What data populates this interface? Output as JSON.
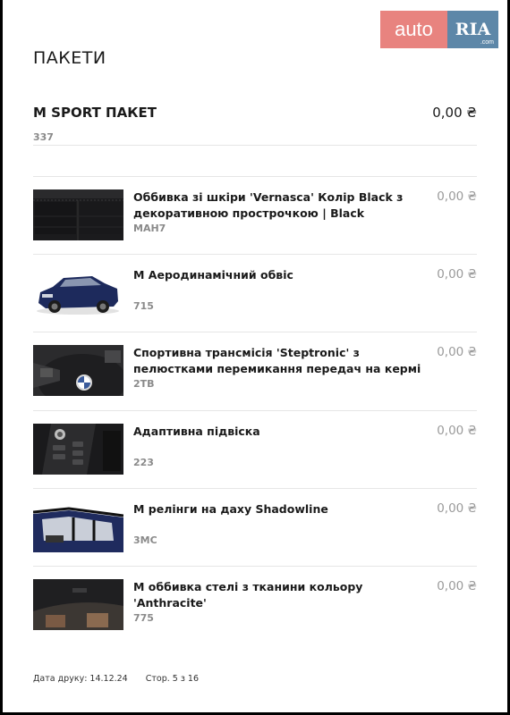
{
  "logo": {
    "part1": "auto",
    "part2": "RIA",
    "part3": ".com"
  },
  "title": "ПАКЕТИ",
  "package": {
    "name": "M SPORT ПАКЕТ",
    "price": "0,00 ₴",
    "code": "337"
  },
  "items": [
    {
      "name": "Оббивка зі шкіри 'Vernasca' Колір Black  з декоративною прострочкою | Black",
      "code": "MAH7",
      "price": "0,00 ₴",
      "image": "black-leather-upholstery"
    },
    {
      "name": "M Аеродинамічний обвіс",
      "code": "715",
      "price": "0,00 ₴",
      "image": "blue-bmw-suv"
    },
    {
      "name": "Спортивна трансмісія 'Steptronic' з пелюстками перемикання передач на кермі",
      "code": "2TB",
      "price": "0,00 ₴",
      "image": "steering-wheel-paddles"
    },
    {
      "name": "Адаптивна підвіска",
      "code": "223",
      "price": "0,00 ₴",
      "image": "drive-mode-buttons"
    },
    {
      "name": "M релінги на даху Shadowline",
      "code": "3MC",
      "price": "0,00 ₴",
      "image": "roof-rails-side-window"
    },
    {
      "name": "M оббивка стелі з тканини кольору 'Anthracite'",
      "code": "775",
      "price": "0,00 ₴",
      "image": "anthracite-headliner"
    }
  ],
  "footer": {
    "print_date": "Дата друку: 14.12.24",
    "page": "Стор. 5 з 16"
  }
}
